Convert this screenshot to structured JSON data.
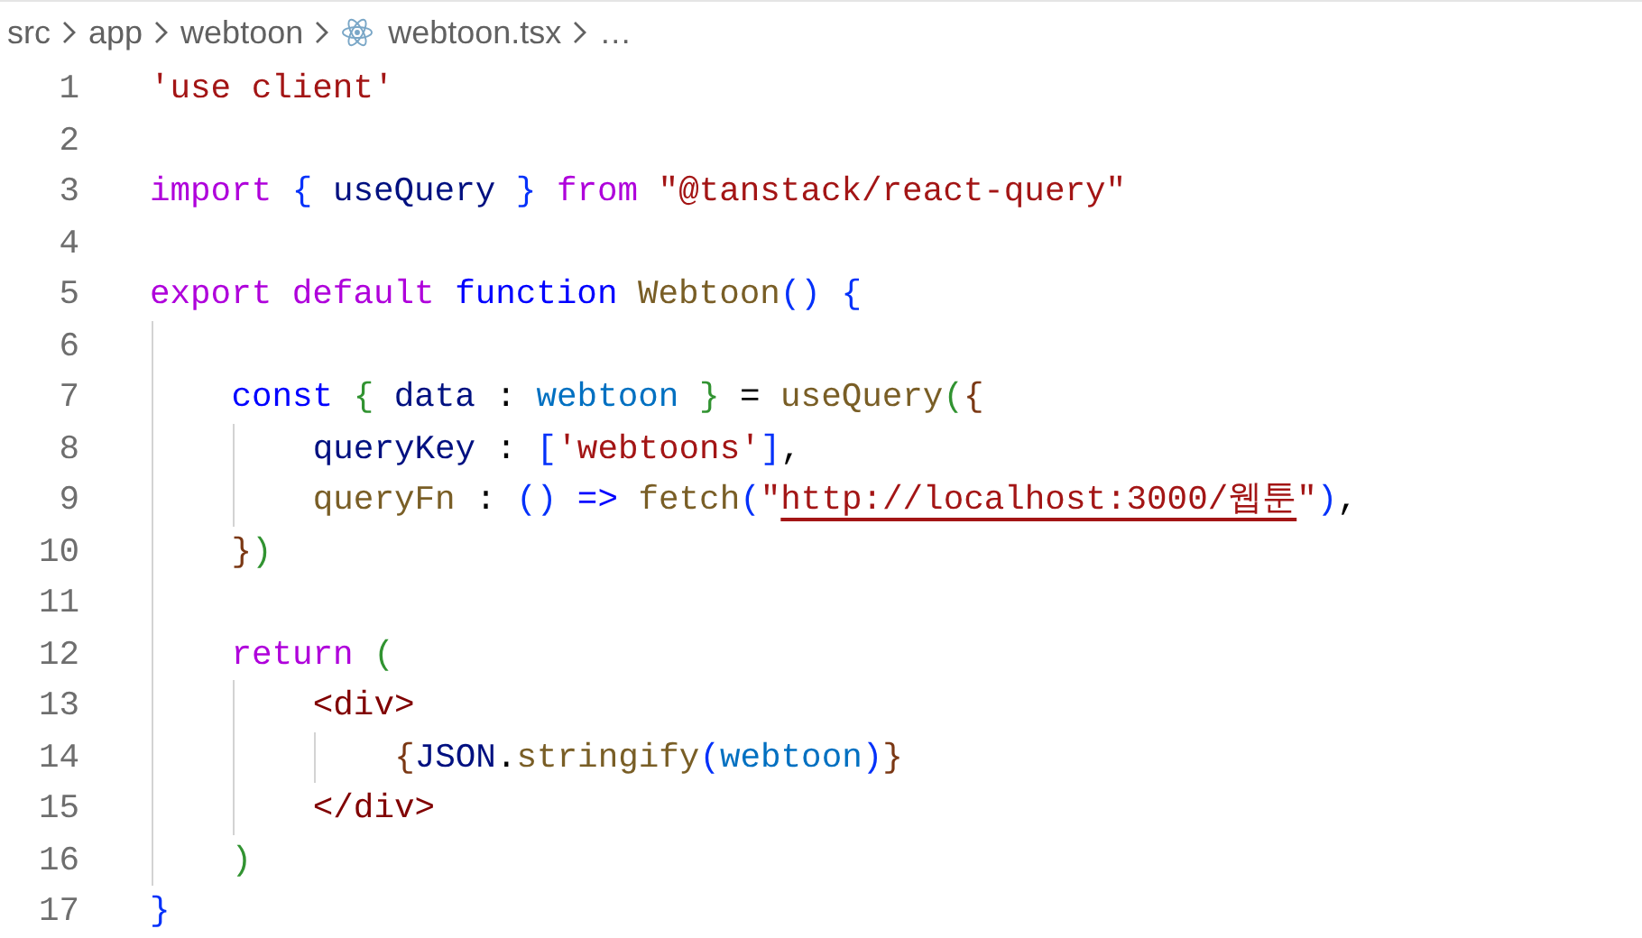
{
  "breadcrumb": [
    {
      "label": "src",
      "kind": "folder"
    },
    {
      "label": "app",
      "kind": "folder"
    },
    {
      "label": "webtoon",
      "kind": "folder"
    },
    {
      "label": "webtoon.tsx",
      "kind": "react-file"
    },
    {
      "label": "…",
      "kind": "more"
    }
  ],
  "lines": [
    {
      "number": "1",
      "tokens": [
        {
          "text": "'use client'",
          "kind": "str"
        }
      ]
    },
    {
      "number": "2"
    },
    {
      "number": "3",
      "tokens": [
        {
          "text": "import ",
          "kind": "kw"
        },
        {
          "text": "{ ",
          "kind": "b1"
        },
        {
          "text": "useQuery ",
          "kind": "var"
        },
        {
          "text": "} ",
          "kind": "b1"
        },
        {
          "text": "from ",
          "kind": "kw"
        },
        {
          "text": "\"@tanstack/react-query\"",
          "kind": "str"
        }
      ]
    },
    {
      "number": "4"
    },
    {
      "number": "5",
      "tokens": [
        {
          "text": "export default ",
          "kind": "kw"
        },
        {
          "text": "function ",
          "kind": "storage"
        },
        {
          "text": "Webtoon",
          "kind": "fn"
        },
        {
          "text": "() ",
          "kind": "b1"
        },
        {
          "text": "{",
          "kind": "b1"
        }
      ],
      "children": [
        {
          "number": "6"
        },
        {
          "number": "7",
          "tokens": [
            {
              "text": "const ",
              "kind": "storage"
            },
            {
              "text": "{ ",
              "kind": "b2"
            },
            {
              "text": "data",
              "kind": "var"
            },
            {
              "text": " : "
            },
            {
              "text": "webtoon ",
              "kind": "const"
            },
            {
              "text": "}",
              "kind": "b2"
            },
            {
              "text": " = "
            },
            {
              "text": "useQuery",
              "kind": "fn"
            },
            {
              "text": "(",
              "kind": "b2"
            },
            {
              "text": "{",
              "kind": "b3"
            }
          ],
          "children": [
            {
              "number": "8",
              "tokens": [
                {
                  "text": "queryKey",
                  "kind": "var"
                },
                {
                  "text": " : "
                },
                {
                  "text": "[",
                  "kind": "b1"
                },
                {
                  "text": "'webtoons'",
                  "kind": "str"
                },
                {
                  "text": "]",
                  "kind": "b1"
                },
                {
                  "text": ","
                }
              ]
            },
            {
              "number": "9",
              "tokens": [
                {
                  "text": "queryFn",
                  "kind": "fn"
                },
                {
                  "text": " : "
                },
                {
                  "text": "() ",
                  "kind": "b1"
                },
                {
                  "text": "=> ",
                  "kind": "storage"
                },
                {
                  "text": "fetch",
                  "kind": "fn"
                },
                {
                  "text": "(",
                  "kind": "b1"
                },
                {
                  "text": "\"",
                  "kind": "str"
                },
                {
                  "text": "http://localhost:3000/웹툰",
                  "kind": "str",
                  "underlined": true
                },
                {
                  "text": "\"",
                  "kind": "str"
                },
                {
                  "text": ")",
                  "kind": "b1"
                },
                {
                  "text": ","
                }
              ]
            }
          ]
        },
        {
          "number": "10",
          "tokens": [
            {
              "text": "}",
              "kind": "b3"
            },
            {
              "text": ")",
              "kind": "b2"
            }
          ]
        },
        {
          "number": "11"
        },
        {
          "number": "12",
          "tokens": [
            {
              "text": "return ",
              "kind": "kw"
            },
            {
              "text": "(",
              "kind": "b2"
            }
          ],
          "children": [
            {
              "number": "13",
              "tokens": [
                {
                  "text": "<div>",
                  "kind": "tag"
                }
              ],
              "children": [
                {
                  "number": "14",
                  "tokens": [
                    {
                      "text": "{",
                      "kind": "b3"
                    },
                    {
                      "text": "JSON",
                      "kind": "var"
                    },
                    {
                      "text": "."
                    },
                    {
                      "text": "stringify",
                      "kind": "fn"
                    },
                    {
                      "text": "(",
                      "kind": "b1"
                    },
                    {
                      "text": "webtoon",
                      "kind": "const"
                    },
                    {
                      "text": ")",
                      "kind": "b1"
                    },
                    {
                      "text": "}",
                      "kind": "b3"
                    }
                  ]
                }
              ]
            },
            {
              "number": "15",
              "tokens": [
                {
                  "text": "</div>",
                  "kind": "tag"
                }
              ]
            }
          ]
        },
        {
          "number": "16",
          "tokens": [
            {
              "text": ")",
              "kind": "b2"
            }
          ]
        }
      ]
    },
    {
      "number": "17",
      "tokens": [
        {
          "text": "}",
          "kind": "b1"
        }
      ]
    }
  ]
}
